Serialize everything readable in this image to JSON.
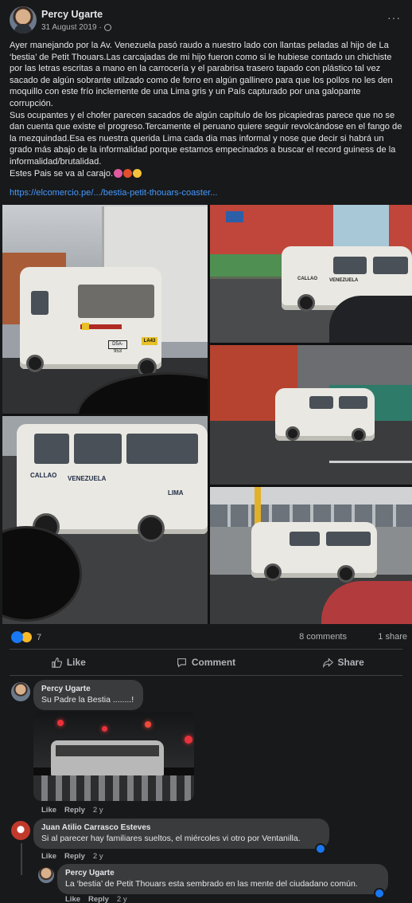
{
  "post": {
    "author": "Percy Ugarte",
    "date": "31 August 2019",
    "separator": "·",
    "privacy_icon": "globe-icon",
    "more_label": "···",
    "paragraphs": [
      "Ayer manejando por la Av. Venezuela  pasó raudo a nuestro lado con llantas peladas al hijo de La ‘bestia’ de Petit Thouars.Las carcajadas de mi hijo fueron como si le hubiese contado un chichiste por las letras escritas a mano en la carrocería y el parabrisa trasero tapado con plástico tal vez sacado de algún sobrante utilzado como de forro en algún gallinero para que los pollos no les den moquillo con este frío inclemente de una Lima gris y un País capturado por una galopante corrupción.",
      "Sus ocupantes y el chofer parecen sacados de algún capítulo de los picapiedras parece que no se dan cuenta que existe el progreso.Tercamente el peruano quiere seguir revolcándose en el fango de la mezquindad.Esa es nuestra querida Lima cada dia mas informal y nose que decir si habrá un grado más abajo de la informalidad porque estamos empecinados a buscar el record guiness de la informalidad/brutalidad.",
      "Estes Pais se va al carajo."
    ],
    "link_text": "https://elcomercio.pe/.../bestia-petit-thouars-coaster...",
    "van_texts": {
      "plate": "D5A-953",
      "route": "LA43",
      "side_callao": "CALLAO",
      "side_venezuela": "VENEZUELA",
      "side_lima": "LIMA"
    }
  },
  "stats": {
    "reaction_count": "7",
    "comments": "8 comments",
    "shares": "1 share"
  },
  "actions": {
    "like": "Like",
    "comment": "Comment",
    "share": "Share"
  },
  "comments": [
    {
      "author": "Percy Ugarte",
      "text": "Su Padre la Bestia ........!",
      "like": "Like",
      "reply": "Reply",
      "age": "2 y"
    },
    {
      "author": "Juan Atilio Carrasco Esteves",
      "text": "Si al parecer hay familiares sueltos, el miércoles vi otro por Ventanilla.",
      "like": "Like",
      "reply": "Reply",
      "age": "2 y"
    },
    {
      "author": "Percy Ugarte",
      "text": "La ‘bestia’ de Petit Thouars esta sembrado en las mente del ciudadano común.",
      "like": "Like",
      "reply": "Reply",
      "age": "2 y"
    }
  ],
  "colors": {
    "background": "#18191a",
    "bubble": "#3a3b3c",
    "link": "#4599ff",
    "like_blue": "#1877f2"
  }
}
